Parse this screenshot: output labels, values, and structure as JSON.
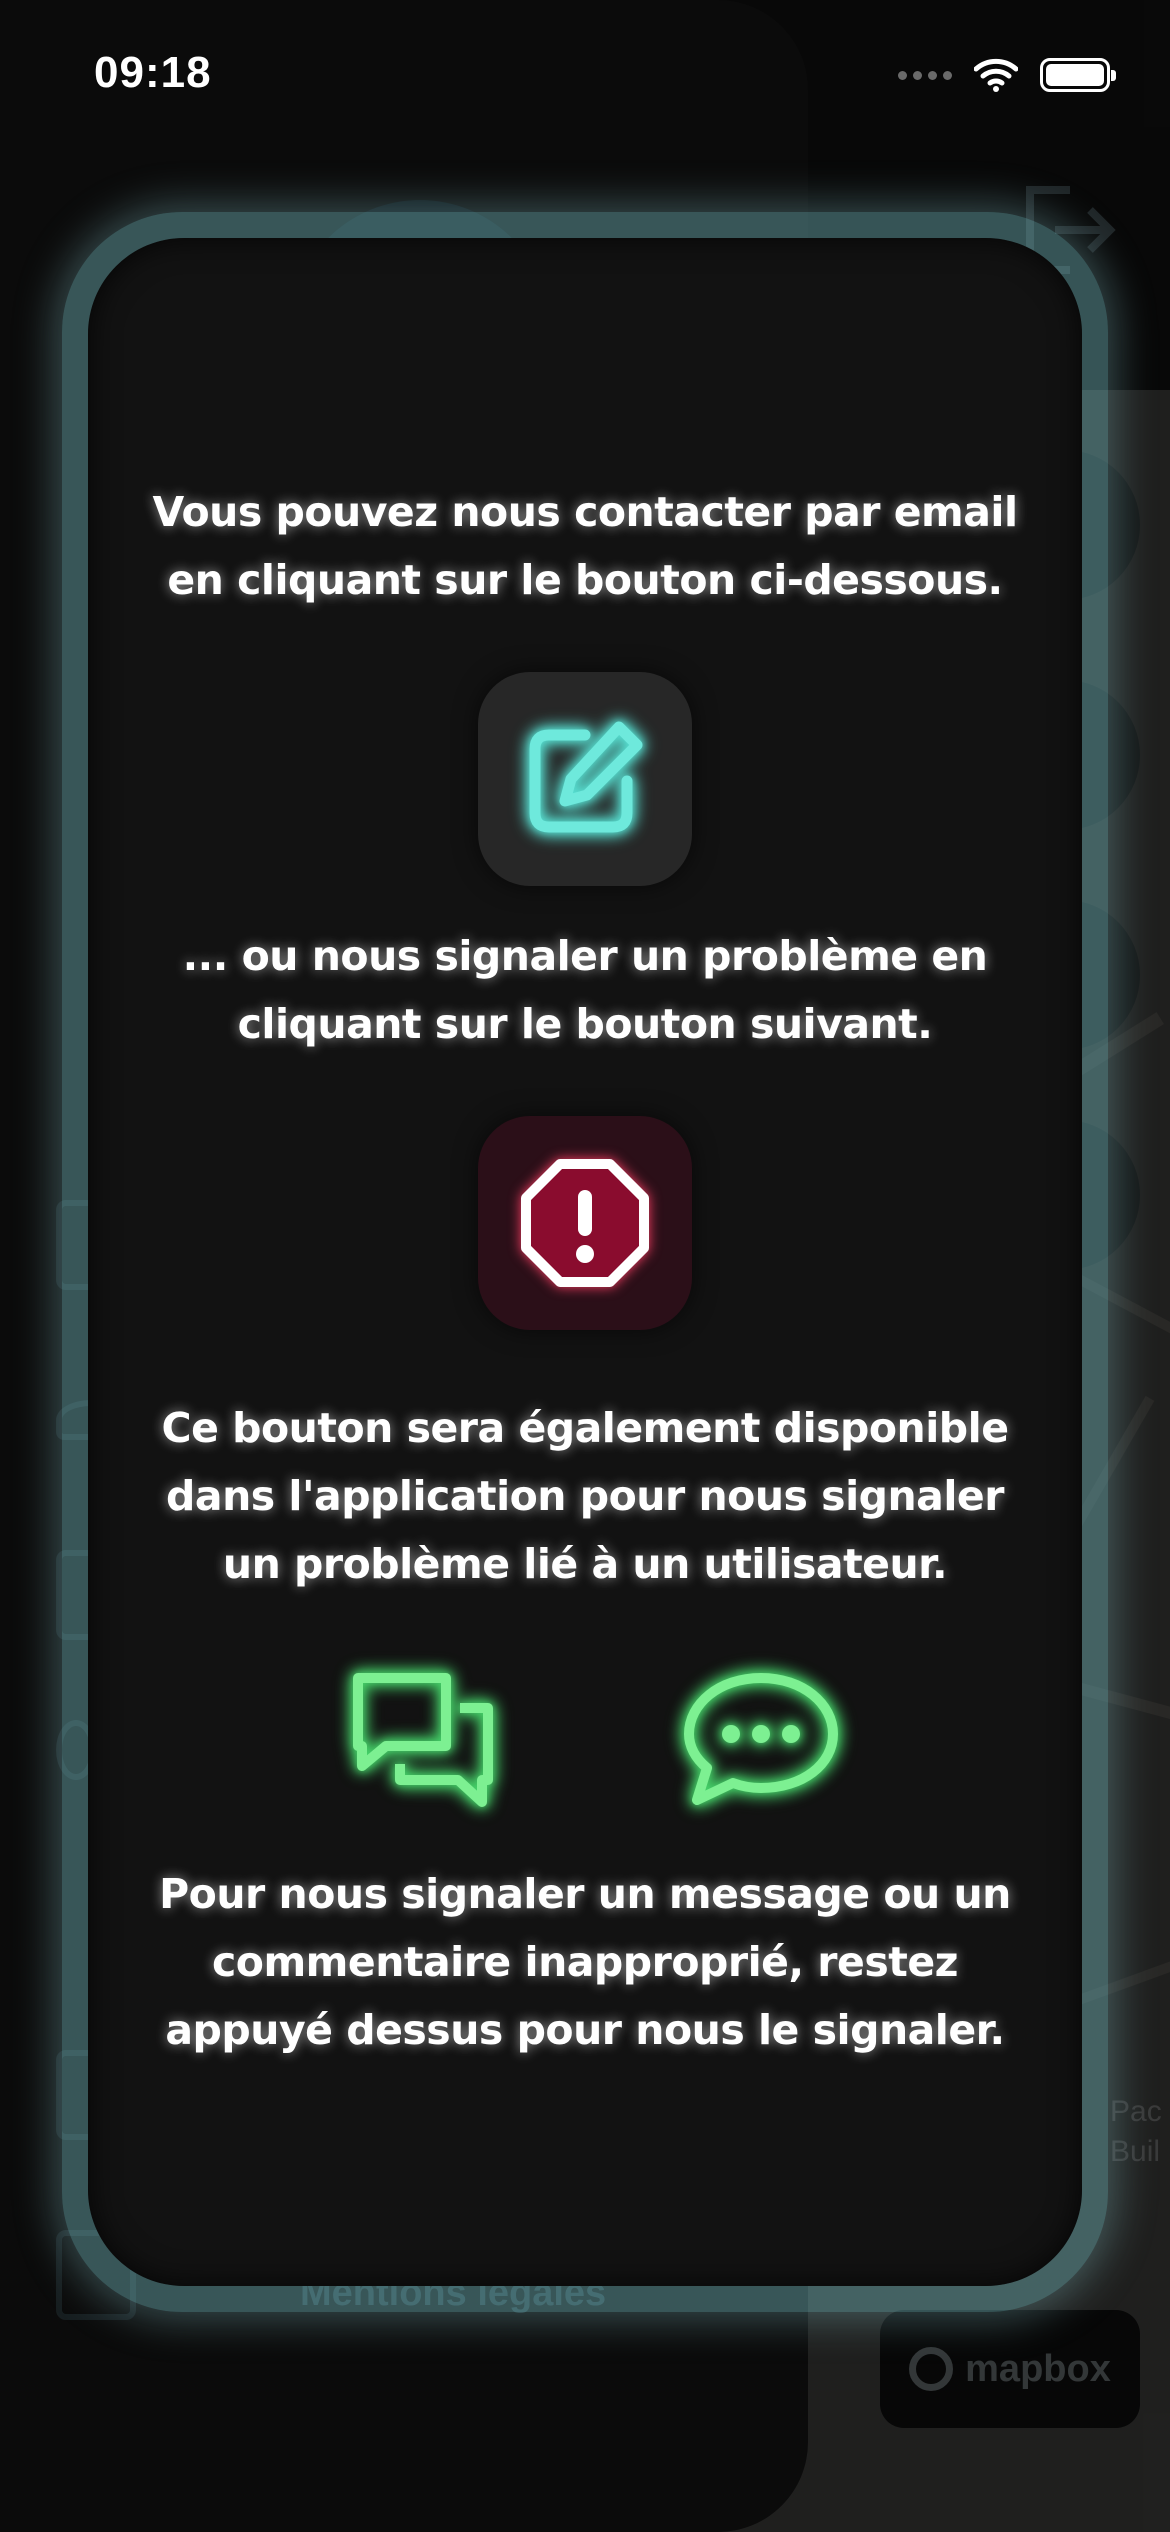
{
  "status_bar": {
    "time": "09:18",
    "wifi_icon": "wifi-icon",
    "battery_icon": "battery-icon"
  },
  "background": {
    "legal_link": "Mentions légales",
    "mapbox_label": "mapbox",
    "map_labels": [
      "Pac",
      "Buil"
    ]
  },
  "modal": {
    "email_text": [
      "Vous pouvez nous contacter par email",
      "en cliquant sur le bouton ci-dessous."
    ],
    "email_button_icon": "edit-icon",
    "report_text": [
      "... ou nous signaler un problème en",
      "cliquant sur le bouton suivant."
    ],
    "report_button_icon": "alert-octagon-icon",
    "availability_text": [
      "Ce bouton sera également disponible",
      "dans l'application pour nous signaler",
      "un problème lié à un utilisateur."
    ],
    "message_icons": [
      "chat-bubbles-icon",
      "chat-dots-icon"
    ],
    "flag_text": [
      "Pour nous signaler un message ou un",
      "commentaire inapproprié, restez",
      "appuyé dessus pour nous le signaler."
    ]
  },
  "colors": {
    "teal_accent": "#57e0d2",
    "report_accent": "#8a0c2e",
    "green_accent": "#46d46a",
    "modal_border": "#78bec3"
  }
}
